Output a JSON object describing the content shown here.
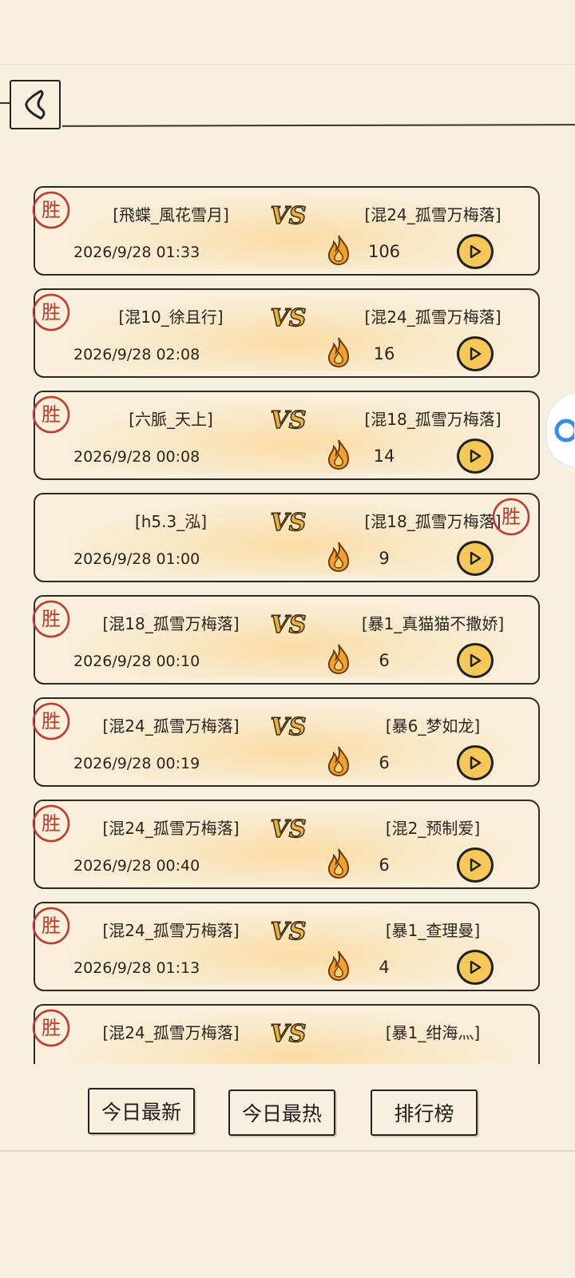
{
  "header": {
    "back_icon": "chevron-left-icon"
  },
  "matches": [
    {
      "left": "[飛蝶_風花雪月]",
      "right": "[混24_孤雪万梅落]",
      "date": "2026/9/28 01:33",
      "hot": "106",
      "winner": "left"
    },
    {
      "left": "[混10_徐且行]",
      "right": "[混24_孤雪万梅落]",
      "date": "2026/9/28 02:08",
      "hot": "16",
      "winner": "left"
    },
    {
      "left": "[六脈_天上]",
      "right": "[混18_孤雪万梅落]",
      "date": "2026/9/28 00:08",
      "hot": "14",
      "winner": "left"
    },
    {
      "left": "[h5.3_泓]",
      "right": "[混18_孤雪万梅落]",
      "date": "2026/9/28 01:00",
      "hot": "9",
      "winner": "right"
    },
    {
      "left": "[混18_孤雪万梅落]",
      "right": "[暴1_真猫猫不撒娇]",
      "date": "2026/9/28 00:10",
      "hot": "6",
      "winner": "left"
    },
    {
      "left": "[混24_孤雪万梅落]",
      "right": "[暴6_梦如龙]",
      "date": "2026/9/28 00:19",
      "hot": "6",
      "winner": "left"
    },
    {
      "left": "[混24_孤雪万梅落]",
      "right": "[混2_预制爱]",
      "date": "2026/9/28 00:40",
      "hot": "6",
      "winner": "left"
    },
    {
      "left": "[混24_孤雪万梅落]",
      "right": "[暴1_查理曼]",
      "date": "2026/9/28 01:13",
      "hot": "4",
      "winner": "left"
    },
    {
      "left": "[混24_孤雪万梅落]",
      "right": "[暴1_绀海灬]",
      "date": "",
      "hot": "",
      "winner": "left"
    }
  ],
  "labels": {
    "vs": "VS",
    "win_stamp": "胜"
  },
  "tabs": {
    "today_new": "今日最新",
    "today_hot": "今日最热",
    "ranking": "排行榜"
  },
  "colors": {
    "background": "#f8f0df",
    "stamp_red": "#c0392b",
    "vs_gold": "#e9b23a",
    "play_fill": "#f6c85a",
    "fire_orange": "#f0a12e"
  }
}
